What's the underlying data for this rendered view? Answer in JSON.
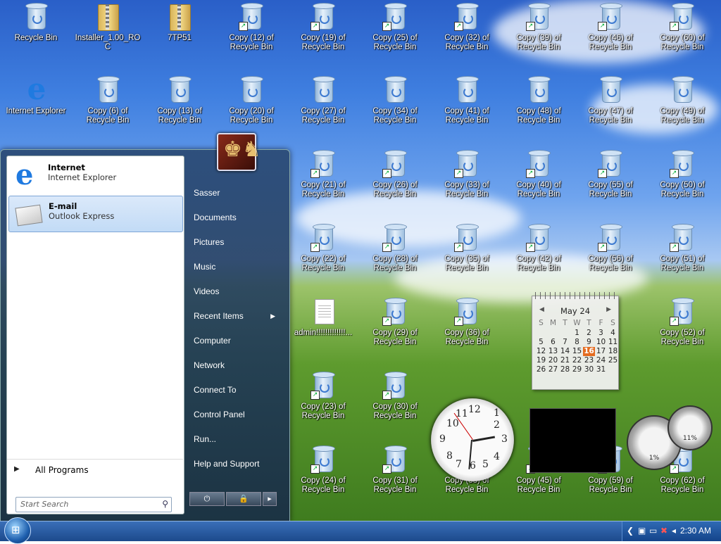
{
  "desktop": {
    "icons": [
      {
        "label": "Recycle Bin",
        "type": "bin",
        "shortcut": false
      },
      {
        "label": "Installer_1.00_ROC",
        "type": "zip",
        "shortcut": false
      },
      {
        "label": "7TP51",
        "type": "zip",
        "shortcut": false
      },
      {
        "label": "Copy (12) of Recycle Bin",
        "type": "bin",
        "shortcut": true
      },
      {
        "label": "Copy (19) of Recycle Bin",
        "type": "bin",
        "shortcut": true
      },
      {
        "label": "Copy (25) of Recycle Bin",
        "type": "bin",
        "shortcut": true
      },
      {
        "label": "Copy (32) of Recycle Bin",
        "type": "bin",
        "shortcut": true
      },
      {
        "label": "Copy (39) of Recycle Bin",
        "type": "bin",
        "shortcut": true
      },
      {
        "label": "Copy (46) of Recycle Bin",
        "type": "bin",
        "shortcut": true
      },
      {
        "label": "Copy (60) of Recycle Bin",
        "type": "bin",
        "shortcut": true
      },
      {
        "label": "Internet Explorer",
        "type": "ie",
        "shortcut": false
      },
      {
        "label": "Copy (6) of Recycle Bin",
        "type": "bin",
        "shortcut": false
      },
      {
        "label": "Copy (13) of Recycle Bin",
        "type": "bin",
        "shortcut": false
      },
      {
        "label": "Copy (20) of Recycle Bin",
        "type": "bin",
        "shortcut": false
      },
      {
        "label": "Copy (27) of Recycle Bin",
        "type": "bin",
        "shortcut": false
      },
      {
        "label": "Copy (34) of Recycle Bin",
        "type": "bin",
        "shortcut": false
      },
      {
        "label": "Copy (41) of Recycle Bin",
        "type": "bin",
        "shortcut": false
      },
      {
        "label": "Copy (48) of Recycle Bin",
        "type": "bin",
        "shortcut": false
      },
      {
        "label": "Copy (47) of Recycle Bin",
        "type": "bin",
        "shortcut": false
      },
      {
        "label": "Copy (49) of Recycle Bin",
        "type": "bin",
        "shortcut": false
      },
      {
        "label": "Copy (21) of Recycle Bin",
        "type": "bin",
        "shortcut": true
      },
      {
        "label": "Copy (26) of Recycle Bin",
        "type": "bin",
        "shortcut": true
      },
      {
        "label": "Copy (33) of Recycle Bin",
        "type": "bin",
        "shortcut": true
      },
      {
        "label": "Copy (40) of Recycle Bin",
        "type": "bin",
        "shortcut": true
      },
      {
        "label": "Copy (55) of Recycle Bin",
        "type": "bin",
        "shortcut": true
      },
      {
        "label": "Copy (50) of Recycle Bin",
        "type": "bin",
        "shortcut": true
      },
      {
        "label": "Copy (22) of Recycle Bin",
        "type": "bin",
        "shortcut": true
      },
      {
        "label": "Copy (28) of Recycle Bin",
        "type": "bin",
        "shortcut": true
      },
      {
        "label": "Copy (35) of Recycle Bin",
        "type": "bin",
        "shortcut": true
      },
      {
        "label": "Copy (42) of Recycle Bin",
        "type": "bin",
        "shortcut": true
      },
      {
        "label": "Copy (56) of Recycle Bin",
        "type": "bin",
        "shortcut": true
      },
      {
        "label": "Copy (51) of Recycle Bin",
        "type": "bin",
        "shortcut": true
      },
      {
        "label": "admin!!!!!!!!!!!!!...",
        "type": "doc",
        "shortcut": false
      },
      {
        "label": "Copy (29) of Recycle Bin",
        "type": "bin",
        "shortcut": true
      },
      {
        "label": "Copy (36) of Recycle Bin",
        "type": "bin",
        "shortcut": true
      },
      {
        "label": "Copy (52) of Recycle Bin",
        "type": "bin",
        "shortcut": true
      },
      {
        "label": "Copy (23) of Recycle Bin",
        "type": "bin",
        "shortcut": true
      },
      {
        "label": "Copy (30) of Recycle Bin",
        "type": "bin",
        "shortcut": true
      },
      {
        "label": "Copy (24) of Recycle Bin",
        "type": "bin",
        "shortcut": true
      },
      {
        "label": "Copy (31) of Recycle Bin",
        "type": "bin",
        "shortcut": true
      },
      {
        "label": "Copy (38) of Recycle Bin",
        "type": "bin",
        "shortcut": true
      },
      {
        "label": "Copy (45) of Recycle Bin",
        "type": "bin",
        "shortcut": true
      },
      {
        "label": "Copy (59) of Recycle Bin",
        "type": "bin",
        "shortcut": true
      },
      {
        "label": "Copy (62) of Recycle Bin",
        "type": "bin",
        "shortcut": true
      }
    ]
  },
  "start_menu": {
    "pinned": [
      {
        "title": "Internet",
        "subtitle": "Internet Explorer",
        "icon": "ie-icon",
        "selected": false
      },
      {
        "title": "E-mail",
        "subtitle": "Outlook Express",
        "icon": "mail-icon",
        "selected": true
      }
    ],
    "all_programs": "All Programs",
    "search_placeholder": "Start Search",
    "right_items": [
      "Sasser",
      "Documents",
      "Pictures",
      "Music",
      "Videos",
      "Recent Items",
      "Computer",
      "Network",
      "Connect To",
      "Control Panel",
      "Run...",
      "Help and Support"
    ]
  },
  "calendar": {
    "month": "May 24",
    "weekdays": [
      "S",
      "M",
      "T",
      "W",
      "T",
      "F",
      "S"
    ],
    "weeks": [
      [
        "",
        "",
        "",
        "",
        "1",
        "2",
        "3",
        "4"
      ],
      [
        "",
        "5",
        "6",
        "7",
        "8",
        "9",
        "10",
        "11"
      ],
      [
        "",
        "12",
        "13",
        "14",
        "15",
        "16",
        "17",
        "18"
      ],
      [
        "",
        "19",
        "20",
        "21",
        "22",
        "23",
        "24",
        "25"
      ],
      [
        "",
        "26",
        "27",
        "28",
        "29",
        "30",
        "31",
        ""
      ]
    ],
    "today": "16"
  },
  "cpu_meter": {
    "cpu": "1%",
    "memory": "11%"
  },
  "taskbar": {
    "time": "2:30 AM"
  }
}
